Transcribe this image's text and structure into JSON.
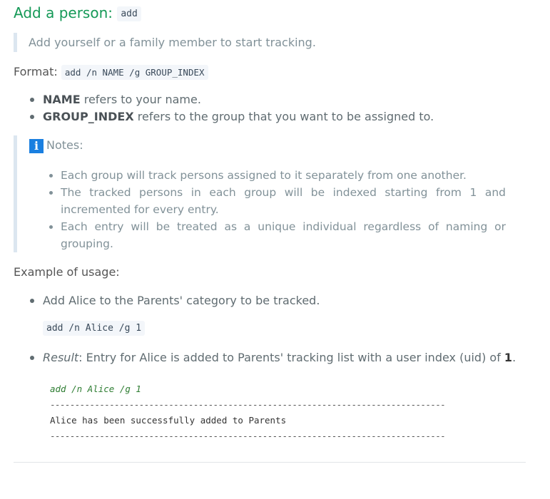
{
  "heading": {
    "title": "Add a person: ",
    "command": "add"
  },
  "description": "Add yourself or a family member to start tracking.",
  "format": {
    "label": "Format: ",
    "syntax": "add /n NAME /g GROUP_INDEX"
  },
  "params": [
    {
      "name": "NAME",
      "text": " refers to your name."
    },
    {
      "name": "GROUP_INDEX",
      "text": " refers to the group that you want to be assigned to."
    }
  ],
  "notes": {
    "icon": "info-icon",
    "title": "Notes:",
    "items": [
      "Each group will track persons assigned to it separately from one another.",
      "The tracked persons in each group will be indexed starting from 1 and incremented for every entry.",
      "Each entry will be treated as a unique individual regardless of naming or grouping."
    ]
  },
  "example": {
    "label": "Example of usage:",
    "step": "Add Alice to the Parents' category to be tracked.",
    "command": "add /n Alice /g 1",
    "result_label": "Result",
    "result_text": ": Entry for Alice is added to Parents' tracking list with a user index (uid) of ",
    "result_value": "1",
    "result_end": "."
  },
  "terminal": {
    "command": "add /n Alice /g 1",
    "divider": "--------------------------------------------------------------------------------",
    "output": "Alice has been successfully added to Parents"
  },
  "colors": {
    "heading": "#159957",
    "info_icon": "#1a7fe0",
    "quote_border": "#dce6f0"
  }
}
